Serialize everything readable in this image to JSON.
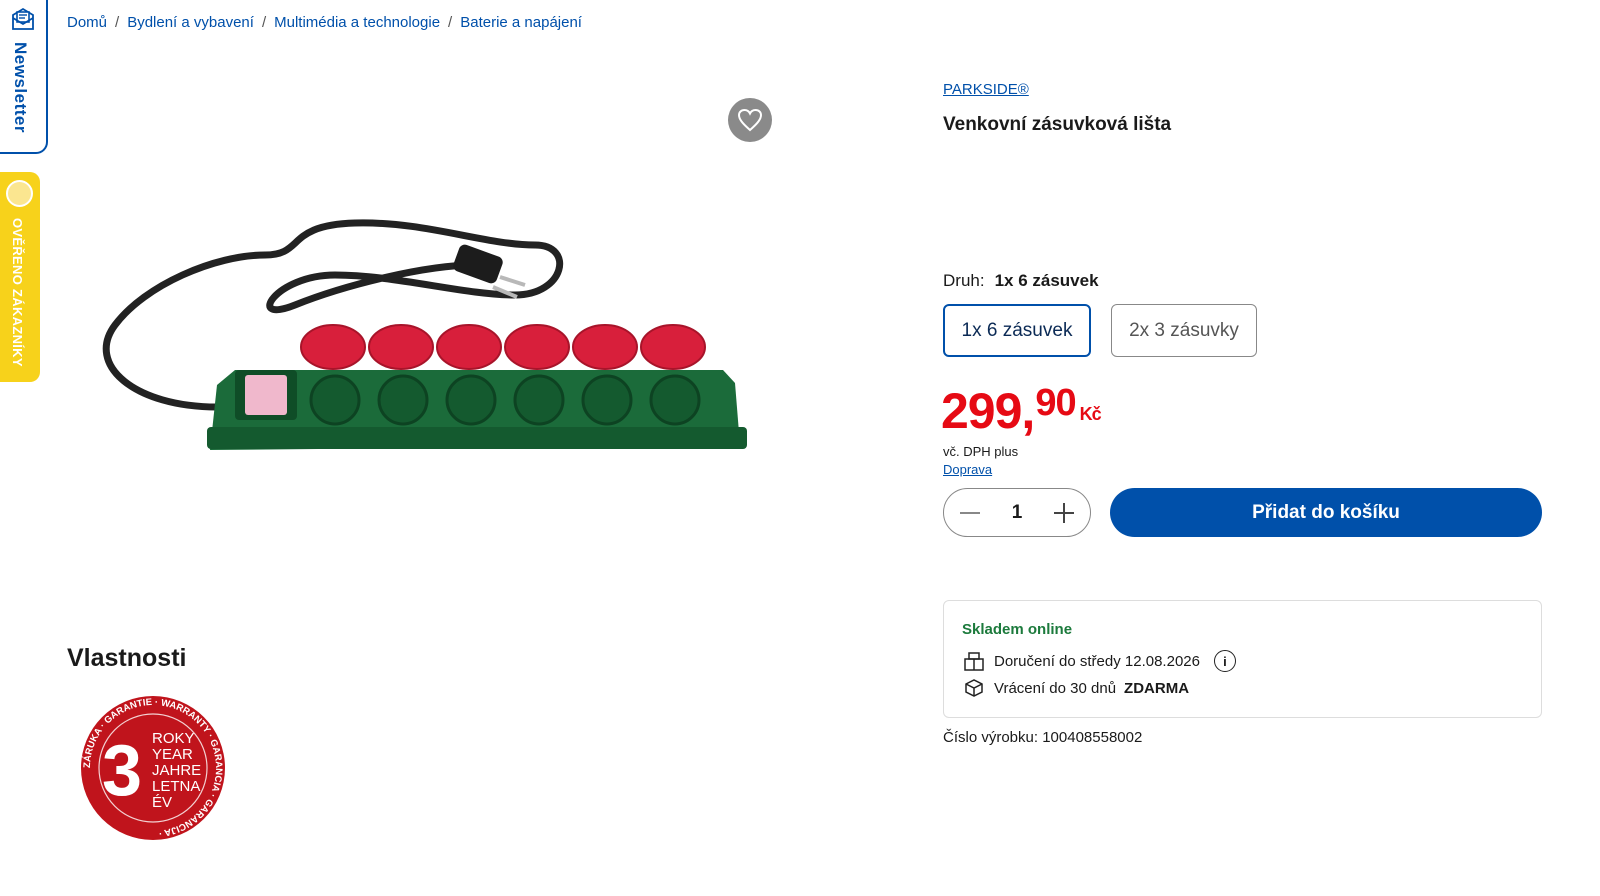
{
  "side_tabs": {
    "newsletter": "Newsletter",
    "verified": "OVĚŘENO ZÁKAZNÍKY"
  },
  "breadcrumb": [
    "Domů",
    "Bydlení a vybavení",
    "Multimédia a technologie",
    "Baterie a napájení"
  ],
  "product": {
    "brand": "PARKSIDE®",
    "title": "Venkovní zásuvková lišta",
    "variant_label": "Druh:",
    "variant_selected": "1x 6 zásuvek",
    "variants": [
      "1x 6 zásuvek",
      "2x 3 zásuvky"
    ],
    "price_int": "299,",
    "price_dec": "90",
    "currency": "Kč",
    "vat": "vč. DPH plus",
    "shipping_link": "Doprava",
    "quantity": "1",
    "add_to_cart": "Přidat do košíku",
    "item_number": "Číslo výrobku: 100408558002"
  },
  "stock": {
    "status": "Skladem online",
    "delivery": "Doručení do středy 12.08.2026",
    "return_prefix": "Vrácení do 30 dnů",
    "return_free": "ZDARMA"
  },
  "features": {
    "title": "Vlastnosti",
    "warranty_number": "3",
    "warranty_lines": [
      "ROKY",
      "YEAR",
      "JAHRE",
      "LETNA",
      "ÉV"
    ],
    "warranty_ring": "ZÁRUKA · GARANTIE · WARRANTY · GARANCIA · GARANCIJA ·"
  },
  "colors": {
    "brand_blue": "#0050aa",
    "price_red": "#e60a14",
    "stock_green": "#1c7a3c",
    "badge_yellow": "#f7d21b"
  }
}
